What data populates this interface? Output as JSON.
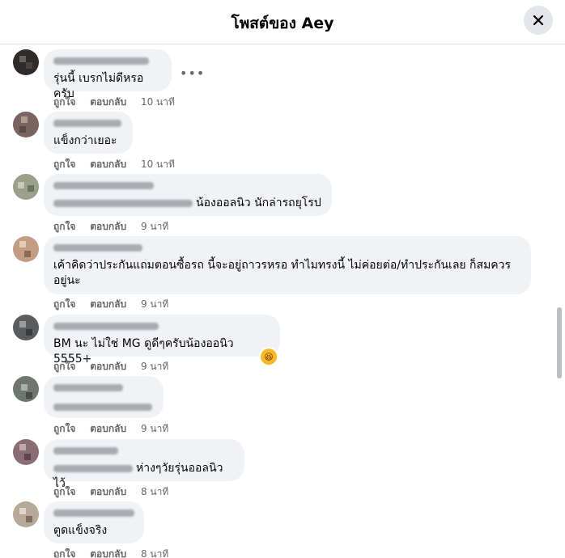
{
  "header": {
    "title": "โพสต์ของ Aey"
  },
  "actions": {
    "like": "ถูกใจ",
    "reply": "ตอบกลับ"
  },
  "comments": [
    {
      "text": "รุ่นนี้ เบรกไม่ดีหรอครับ",
      "time": "10 นาที"
    },
    {
      "text": "แข็งกว่าเยอะ",
      "time": "10 นาที"
    },
    {
      "text": "น้องออลนิว นักล่ารถยุโรป",
      "time": "9 นาที"
    },
    {
      "text": "เค้าคิดว่าประกันแถมตอนซื้อรถ นี้จะอยู่ถาวรหรอ ทำไมทรงนี้ ไม่ค่อยต่อ/ทำประกันเลย ก็สมควรอยู่นะ",
      "time": "9 นาที"
    },
    {
      "text": "BM นะ ไม่ใช่ MG ดูดีๆครับน้องออนิว 5555+",
      "time": "9 นาที"
    },
    {
      "text": "",
      "time": "9 นาที"
    },
    {
      "text": "ห่างๆวัยรุ่นออลนิวไว้",
      "time": "8 นาที"
    },
    {
      "text": "ตูดแข็งจริง",
      "time": "8 นาที"
    }
  ],
  "icons": {
    "close": "close-icon",
    "more": "more-options-icon",
    "reaction": "laughing-emoji-icon"
  },
  "colors": {
    "bubble": "#f0f2f5",
    "meta": "#65676b",
    "text": "#050505"
  }
}
